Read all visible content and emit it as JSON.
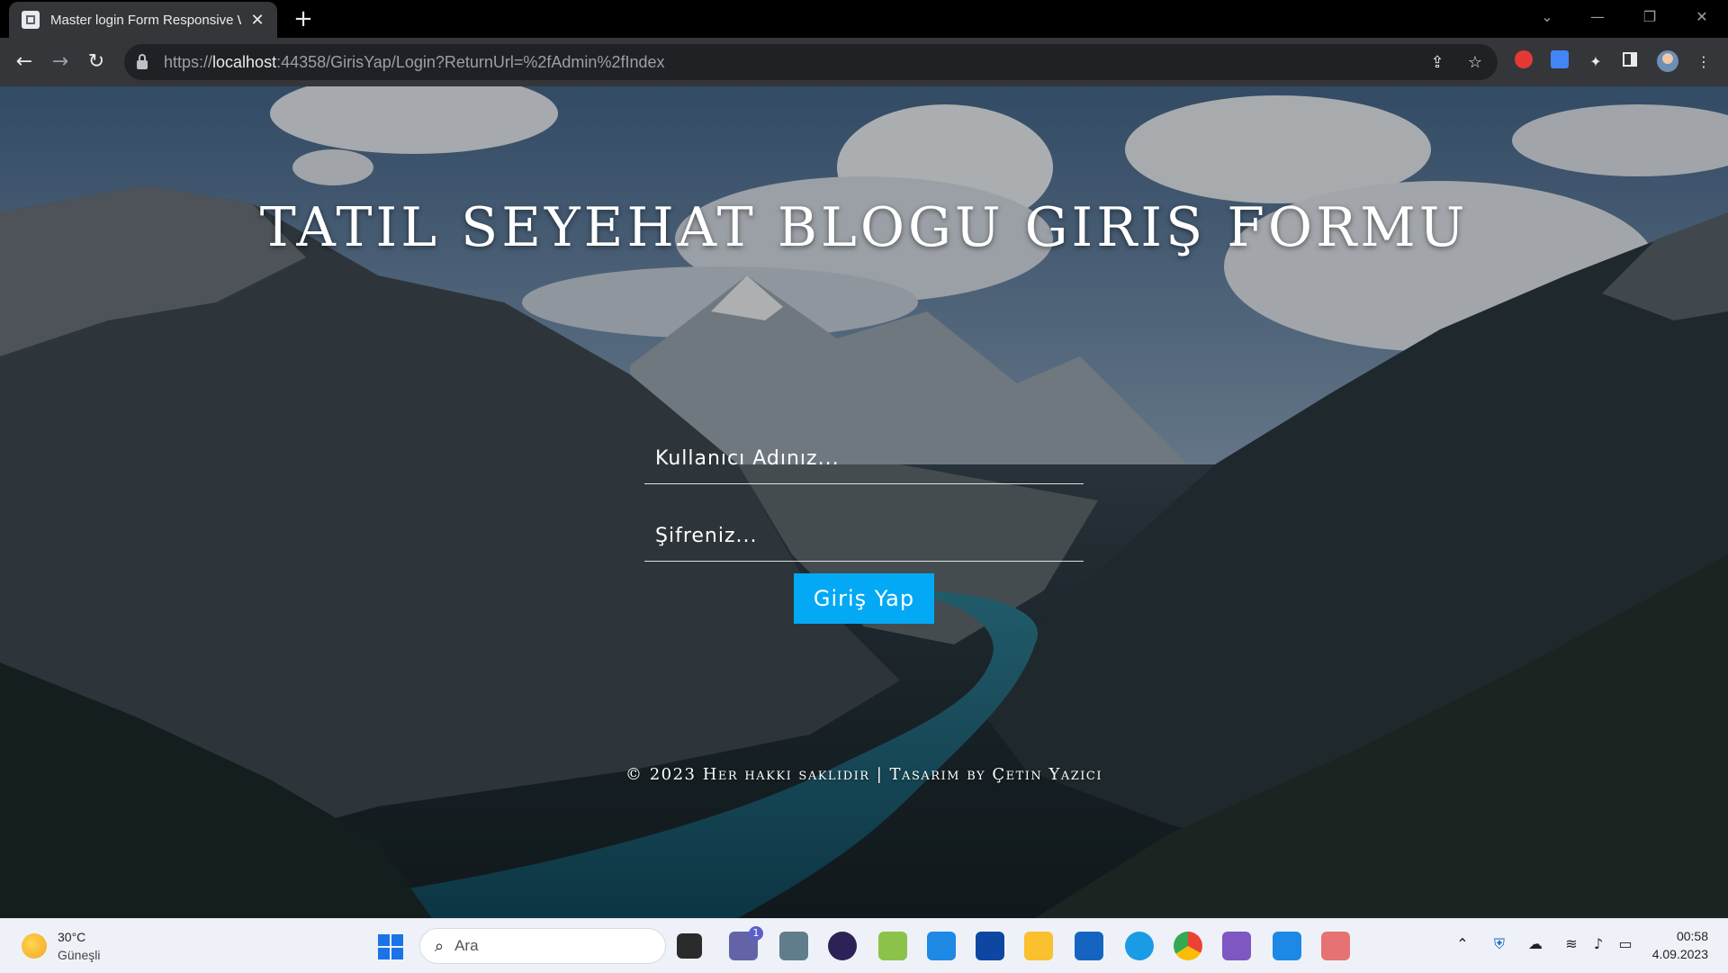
{
  "browser": {
    "tab_title": "Master login Form Responsive W",
    "tab_close": "✕",
    "new_tab": "+",
    "url_prefix": "https://",
    "url_host": "localhost",
    "url_rest": ":44358/GirisYap/Login?ReturnUrl=%2fAdmin%2fIndex"
  },
  "page": {
    "heading": "TATIL SEYEHAT BLOGU GIRIŞ FORMU",
    "username_placeholder": "Kullanıcı Adınız...",
    "password_placeholder": "Şifreniz...",
    "submit_label": "Giriş Yap",
    "footer": "© 2023 Her hakki saklidir | Tasarim by Çetin Yazici"
  },
  "taskbar": {
    "temperature": "30°C",
    "weather": "Güneşli",
    "search_placeholder": "Ara",
    "chat_badge": "1",
    "time": "00:58",
    "date": "4.09.2023"
  }
}
